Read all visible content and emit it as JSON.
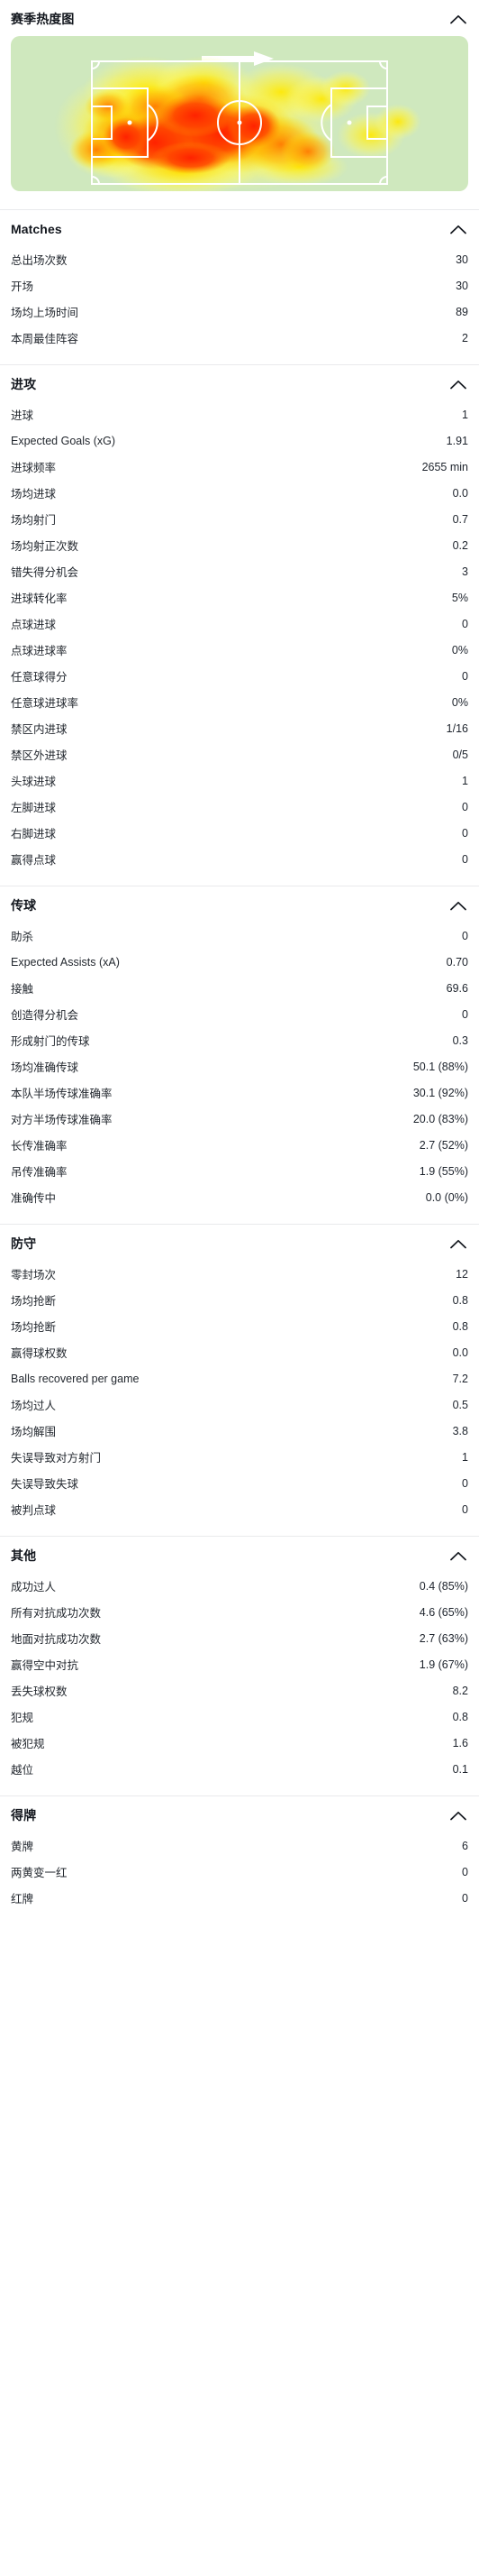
{
  "heatmap": {
    "title": "赛季热度图",
    "collapse_icon": "chevron-up-icon",
    "direction_icon": "arrow-right-icon",
    "pitch_color": "#cfe8be",
    "line_color": "#ffffff",
    "heat_colors": [
      "#ffff4d",
      "#ffa500",
      "#ff2a00"
    ]
  },
  "sections": [
    {
      "id": "matches",
      "title": "Matches",
      "collapse_icon": "chevron-up-icon",
      "rows": [
        {
          "label": "总出场次数",
          "value": "30"
        },
        {
          "label": "开场",
          "value": "30"
        },
        {
          "label": "场均上场时间",
          "value": "89"
        },
        {
          "label": "本周最佳阵容",
          "value": "2"
        }
      ]
    },
    {
      "id": "attack",
      "title": "进攻",
      "collapse_icon": "chevron-up-icon",
      "rows": [
        {
          "label": "进球",
          "value": "1"
        },
        {
          "label": "Expected Goals (xG)",
          "value": "1.91"
        },
        {
          "label": "进球频率",
          "value": "2655 min"
        },
        {
          "label": "场均进球",
          "value": "0.0"
        },
        {
          "label": "场均射门",
          "value": "0.7"
        },
        {
          "label": "场均射正次数",
          "value": "0.2"
        },
        {
          "label": "错失得分机会",
          "value": "3"
        },
        {
          "label": "进球转化率",
          "value": "5%"
        },
        {
          "label": "点球进球",
          "value": "0"
        },
        {
          "label": "点球进球率",
          "value": "0%"
        },
        {
          "label": "任意球得分",
          "value": "0"
        },
        {
          "label": "任意球进球率",
          "value": "0%"
        },
        {
          "label": "禁区内进球",
          "value": "1/16"
        },
        {
          "label": "禁区外进球",
          "value": "0/5"
        },
        {
          "label": "头球进球",
          "value": "1"
        },
        {
          "label": "左脚进球",
          "value": "0"
        },
        {
          "label": "右脚进球",
          "value": "0"
        },
        {
          "label": "赢得点球",
          "value": "0"
        }
      ]
    },
    {
      "id": "passing",
      "title": "传球",
      "collapse_icon": "chevron-up-icon",
      "rows": [
        {
          "label": "助杀",
          "value": "0"
        },
        {
          "label": "Expected Assists (xA)",
          "value": "0.70"
        },
        {
          "label": "接触",
          "value": "69.6"
        },
        {
          "label": "创造得分机会",
          "value": "0"
        },
        {
          "label": "形成射门的传球",
          "value": "0.3"
        },
        {
          "label": "场均准确传球",
          "value": "50.1 (88%)"
        },
        {
          "label": "本队半场传球准确率",
          "value": "30.1 (92%)"
        },
        {
          "label": "对方半场传球准确率",
          "value": "20.0 (83%)"
        },
        {
          "label": "长传准确率",
          "value": "2.7 (52%)"
        },
        {
          "label": "吊传准确率",
          "value": "1.9 (55%)"
        },
        {
          "label": "准确传中",
          "value": "0.0 (0%)"
        }
      ]
    },
    {
      "id": "defense",
      "title": "防守",
      "collapse_icon": "chevron-up-icon",
      "rows": [
        {
          "label": "零封场次",
          "value": "12"
        },
        {
          "label": "场均抢断",
          "value": "0.8"
        },
        {
          "label": "场均抢断",
          "value": "0.8"
        },
        {
          "label": "赢得球权数",
          "value": "0.0"
        },
        {
          "label": "Balls recovered per game",
          "value": "7.2"
        },
        {
          "label": "场均过人",
          "value": "0.5"
        },
        {
          "label": "场均解围",
          "value": "3.8"
        },
        {
          "label": "失误导致对方射门",
          "value": "1"
        },
        {
          "label": "失误导致失球",
          "value": "0"
        },
        {
          "label": "被判点球",
          "value": "0"
        }
      ]
    },
    {
      "id": "other",
      "title": "其他",
      "collapse_icon": "chevron-up-icon",
      "rows": [
        {
          "label": "成功过人",
          "value": "0.4 (85%)"
        },
        {
          "label": "所有对抗成功次数",
          "value": "4.6 (65%)"
        },
        {
          "label": "地面对抗成功次数",
          "value": "2.7 (63%)"
        },
        {
          "label": "赢得空中对抗",
          "value": "1.9 (67%)"
        },
        {
          "label": "丢失球权数",
          "value": "8.2"
        },
        {
          "label": "犯规",
          "value": "0.8"
        },
        {
          "label": "被犯规",
          "value": "1.6"
        },
        {
          "label": "越位",
          "value": "0.1"
        }
      ]
    },
    {
      "id": "cards",
      "title": "得牌",
      "collapse_icon": "chevron-up-icon",
      "rows": [
        {
          "label": "黄牌",
          "value": "6"
        },
        {
          "label": "两黄变一红",
          "value": "0"
        },
        {
          "label": "红牌",
          "value": "0"
        }
      ]
    }
  ]
}
